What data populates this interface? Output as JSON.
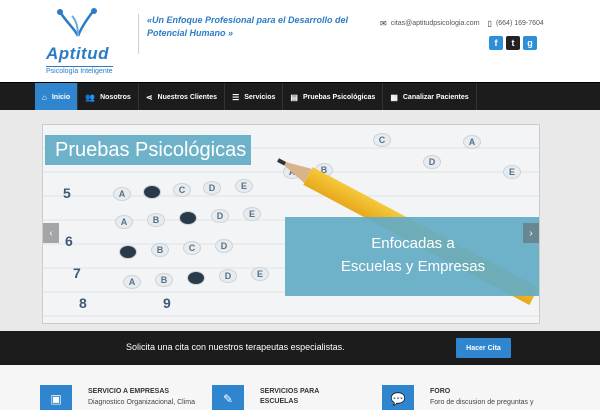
{
  "header": {
    "logo_name": "Aptitud",
    "logo_sub": "Psicología Inteligente",
    "tagline": "«Un Enfoque Profesional para el Desarrollo del Potencial Humano »",
    "email": "citas@aptitudpsicologia.com",
    "phone": "(664) 169-7604",
    "social": [
      {
        "icon": "facebook-icon",
        "glyph": "f"
      },
      {
        "icon": "twitter-icon",
        "glyph": "t"
      },
      {
        "icon": "google-icon",
        "glyph": "g"
      }
    ]
  },
  "nav": {
    "items": [
      {
        "label": "Inicio",
        "icon": "home-icon",
        "glyph": "⌂",
        "active": true
      },
      {
        "label": "Nosotros",
        "icon": "users-icon",
        "glyph": "👥"
      },
      {
        "label": "Nuestros Clientes",
        "icon": "share-icon",
        "glyph": "⋖"
      },
      {
        "label": "Servicios",
        "icon": "list-icon",
        "glyph": "☰"
      },
      {
        "label": "Pruebas Psicológicas",
        "icon": "document-icon",
        "glyph": "▤"
      },
      {
        "label": "Canalizar Pacientes",
        "icon": "forms-icon",
        "glyph": "▦"
      }
    ]
  },
  "slider": {
    "title": "Pruebas Psicológicas",
    "subtitle_line1": "Enfocadas a",
    "subtitle_line2": "Escuelas y Empresas",
    "prev": "‹",
    "next": "›",
    "numbers": [
      "5",
      "6",
      "7",
      "8",
      "9"
    ],
    "bubble_letters": [
      "A",
      "B",
      "C",
      "D",
      "E"
    ]
  },
  "cta": {
    "text": "Solicita una cita con nuestros terapeutas especialistas.",
    "button": "Hacer Cita"
  },
  "services": [
    {
      "title": "SERVICIO A EMPRESAS",
      "desc": "Diagnostico Organizacional, Clima",
      "icon": "briefcase-icon",
      "glyph": "▣"
    },
    {
      "title": "SERVICIOS PARA ESCUELAS",
      "desc": "",
      "icon": "pencil-icon",
      "glyph": "✎"
    },
    {
      "title": "FORO",
      "desc": "Foro de discusion de preguntas y",
      "icon": "chat-icon",
      "glyph": "💬"
    }
  ],
  "colors": {
    "accent": "#2f86cf",
    "banner": "#63abc4",
    "dark": "#1c1c1c",
    "brand": "#2b7cc4"
  }
}
